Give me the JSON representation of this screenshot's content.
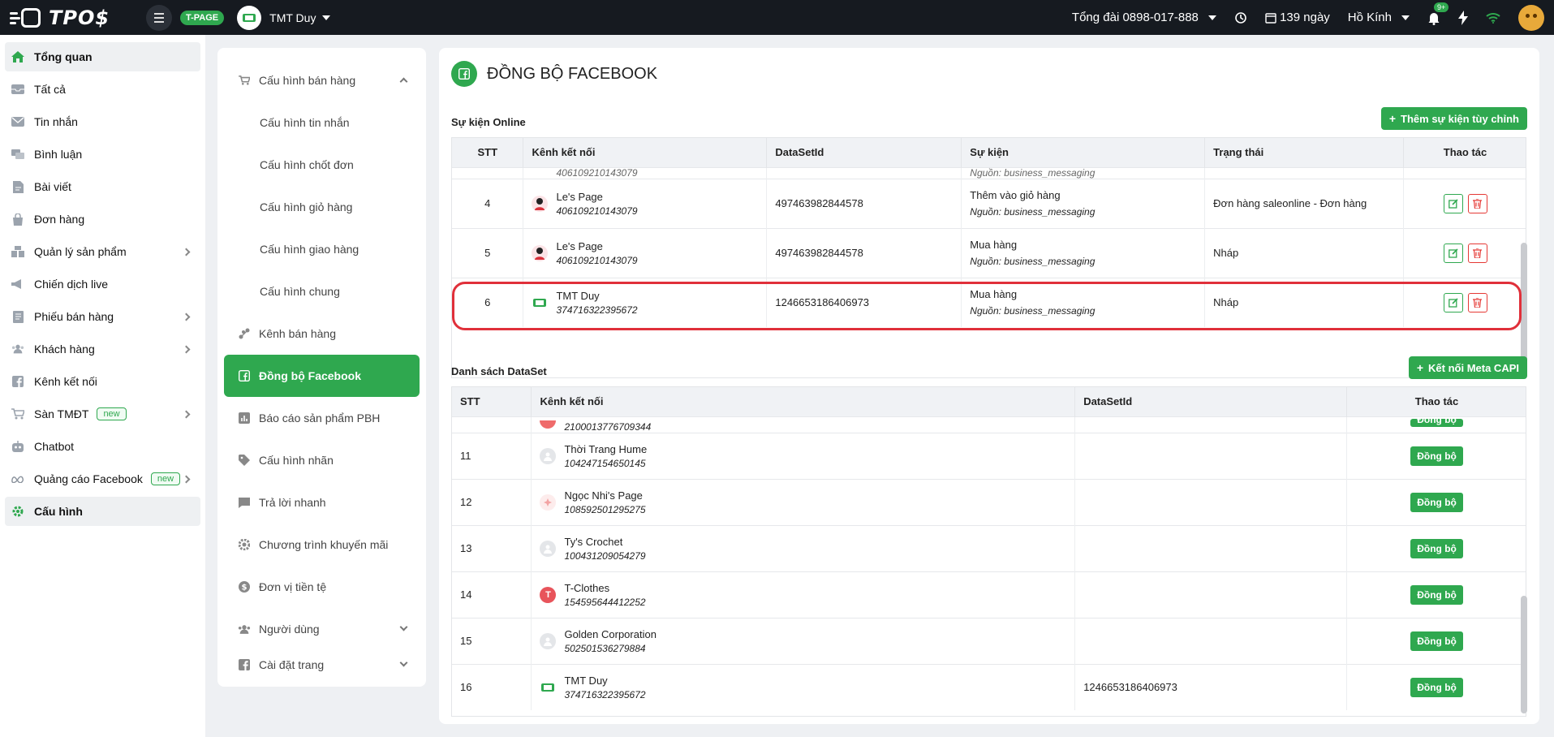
{
  "topbar": {
    "brand": "TPO$",
    "tpage_badge": "T-PAGE",
    "shop_name": "TMT Duy",
    "hotline_label": "Tổng đài",
    "hotline_number": "0898-017-888",
    "days_left": "139 ngày",
    "user_name": "Hồ Kính",
    "notif_count": "9+"
  },
  "sidebar": {
    "items": [
      {
        "label": "Tổng quan",
        "icon": "home-icon"
      },
      {
        "label": "Tất cả",
        "icon": "inbox-icon"
      },
      {
        "label": "Tin nhắn",
        "icon": "mail-icon"
      },
      {
        "label": "Bình luận",
        "icon": "comment-icon"
      },
      {
        "label": "Bài viết",
        "icon": "post-icon"
      },
      {
        "label": "Đơn hàng",
        "icon": "bag-icon"
      },
      {
        "label": "Quản lý sản phẩm",
        "icon": "product-icon"
      },
      {
        "label": "Chiến dịch live",
        "icon": "megaphone-icon"
      },
      {
        "label": "Phiếu bán hàng",
        "icon": "receipt-icon"
      },
      {
        "label": "Khách hàng",
        "icon": "users-icon"
      },
      {
        "label": "Kênh kết nối",
        "icon": "facebook-icon"
      },
      {
        "label": "Sàn TMĐT",
        "icon": "cart-icon",
        "tag": "new"
      },
      {
        "label": "Chatbot",
        "icon": "bot-icon"
      },
      {
        "label": "Quảng cáo Facebook",
        "icon": "meta-icon",
        "tag": "new"
      },
      {
        "label": "Cấu hình",
        "icon": "gear-icon"
      }
    ]
  },
  "config_menu": {
    "sales_config": "Cấu hình bán hàng",
    "sub": [
      "Cấu hình tin nhắn",
      "Cấu hình chốt đơn",
      "Cấu hình giỏ hàng",
      "Cấu hình giao hàng",
      "Cấu hình chung"
    ],
    "sales_channel": "Kênh bán hàng",
    "fb_sync": "Đồng bộ Facebook",
    "pbh_report": "Báo cáo sản phẩm PBH",
    "label_config": "Cấu hình nhãn",
    "quick_reply": "Trả lời nhanh",
    "promotion": "Chương trình khuyến mãi",
    "currency": "Đơn vị tiền tệ",
    "users": "Người dùng",
    "page_settings": "Cài đặt trang"
  },
  "main": {
    "title": "ĐỒNG BỘ FACEBOOK",
    "online_events": {
      "title": "Sự kiện Online",
      "add_button": "Thêm sự kiện tùy chỉnh",
      "headers": [
        "STT",
        "Kênh kết nối",
        "DataSetId",
        "Sự kiện",
        "Trạng thái",
        "Thao tác"
      ],
      "partial_top": {
        "id": "406109210143079",
        "source": "Nguồn: business_messaging"
      },
      "rows": [
        {
          "stt": "4",
          "channel": "Le's Page",
          "channel_id": "406109210143079",
          "dataset": "497463982844578",
          "event": "Thêm vào giỏ hàng",
          "source": "Nguồn: business_messaging",
          "status": "Đơn hàng saleonline - Đơn hàng"
        },
        {
          "stt": "5",
          "channel": "Le's Page",
          "channel_id": "406109210143079",
          "dataset": "497463982844578",
          "event": "Mua hàng",
          "source": "Nguồn: business_messaging",
          "status": "Nháp"
        },
        {
          "stt": "6",
          "channel": "TMT Duy",
          "channel_id": "374716322395672",
          "dataset": "1246653186406973",
          "event": "Mua hàng",
          "source": "Nguồn: business_messaging",
          "status": "Nháp"
        }
      ]
    },
    "datasets": {
      "title": "Danh sách DataSet",
      "connect_button": "Kết nối Meta CAPI",
      "headers": [
        "STT",
        "Kênh kết nối",
        "DataSetId",
        "Thao tác"
      ],
      "sync_label": "Đồng bộ",
      "partial_top": {
        "id": "2100013776709344"
      },
      "rows": [
        {
          "stt": "11",
          "channel": "Thời Trang Hume",
          "channel_id": "104247154650145",
          "dataset": ""
        },
        {
          "stt": "12",
          "channel": "Ngọc Nhi's Page",
          "channel_id": "108592501295275",
          "dataset": ""
        },
        {
          "stt": "13",
          "channel": "Ty's Crochet",
          "channel_id": "100431209054279",
          "dataset": ""
        },
        {
          "stt": "14",
          "channel": "T-Clothes",
          "channel_id": "154595644412252",
          "dataset": "",
          "avatar_letter": "T"
        },
        {
          "stt": "15",
          "channel": "Golden Corporation",
          "channel_id": "502501536279884",
          "dataset": ""
        },
        {
          "stt": "16",
          "channel": "TMT Duy",
          "channel_id": "374716322395672",
          "dataset": "1246653186406973"
        }
      ]
    }
  },
  "colors": {
    "accent": "#2fa84f",
    "danger": "#e53935",
    "topbar": "#161a20"
  }
}
